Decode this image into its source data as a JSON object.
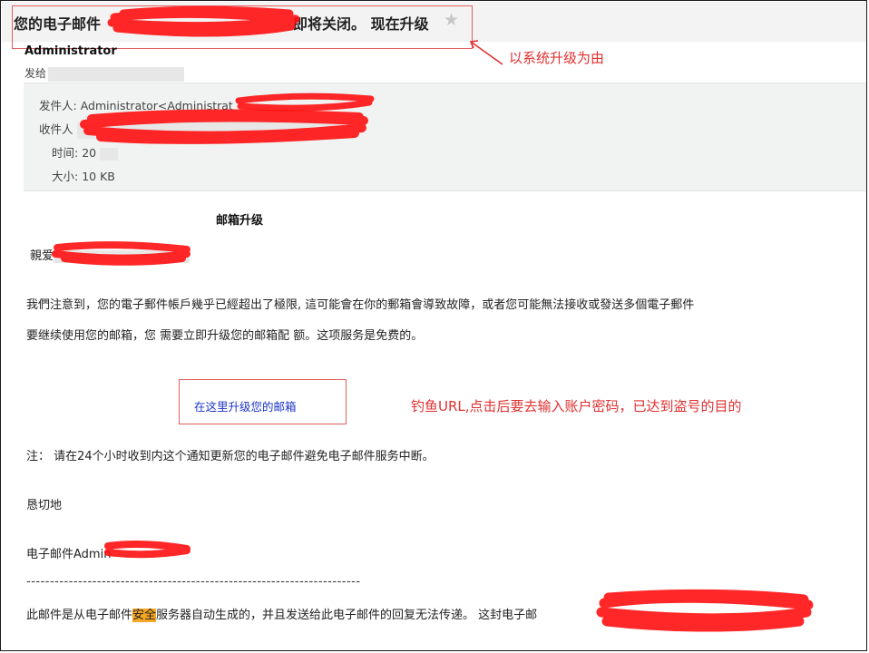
{
  "email": {
    "subject_prefix": "您的电子邮件",
    "subject_suffix": "即将关闭。 现在升级",
    "sender_name": "Administrator",
    "send_to_label": "发给",
    "from_label": "发件人:",
    "from_value": "Administrator<Administrat",
    "to_label": "收件人",
    "time_label": "时间:",
    "time_value": "20",
    "size_label": "大小:",
    "size_value": "10 KB"
  },
  "annotations": {
    "subject_note": "以系统升级为由",
    "link_note": "钓鱼URL,点击后要去输入账户密码，已达到盗号的目的"
  },
  "body": {
    "title": "邮箱升级",
    "greeting": "親爱",
    "para1": "我們注意到，您的電子郵件帳戶幾乎已經超出了極限, 這可能會在你的郵箱會導致故障，或者您可能無法接收或發送多個電子郵件",
    "para2": "要继续使用您的邮箱，您 需要立即升级您的邮箱配 额。这项服务是免费的。",
    "link_text": "在这里升级您的邮箱",
    "note": "注： 请在24个小时收到内这个通知更新您的电子邮件避免电子邮件服务中断。",
    "closing": "恳切地",
    "signature": "电子邮件Admin",
    "divider": "-----------------------------------------------------------------------",
    "footer_before": "此邮件是从电子邮件",
    "footer_highlight": "安全",
    "footer_after": "服务器自动生成的，并且发送给此电子邮件的回复无法传递。 这封电子邮"
  },
  "colors": {
    "annotation_red": "#e03030",
    "redaction_red": "#ff1010",
    "link_blue": "#1b33c8",
    "highlight_orange": "#f5a623"
  }
}
